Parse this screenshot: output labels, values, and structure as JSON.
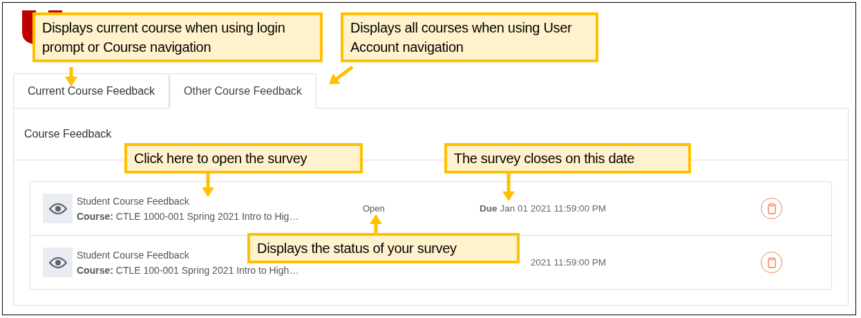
{
  "tabs": [
    {
      "label": "Current Course Feedback",
      "selected": false
    },
    {
      "label": "Other Course Feedback",
      "selected": true
    }
  ],
  "panel": {
    "title": "Course Feedback"
  },
  "rows": [
    {
      "title": "Student Course Feedback",
      "course": "**Course:** CTLE 1000-001 Spring 2021 Intro to Hig…",
      "status": "Open",
      "due": "**Due** Jan 01 2021 11:59:00 PM"
    },
    {
      "title": "Student Course Feedback",
      "course": "**Course:** CTLE 100-001 Spring 2021 Intro to High…",
      "due": "2021 11:59:00 PM"
    }
  ],
  "callouts": [
    {
      "text": "Displays current course when using login prompt or Course navigation"
    },
    {
      "text": "Displays all courses when using User Account navigation"
    },
    {
      "text": "Click here to open the survey"
    },
    {
      "text": "The survey closes on this date"
    },
    {
      "text": "Displays the status of your survey"
    }
  ]
}
